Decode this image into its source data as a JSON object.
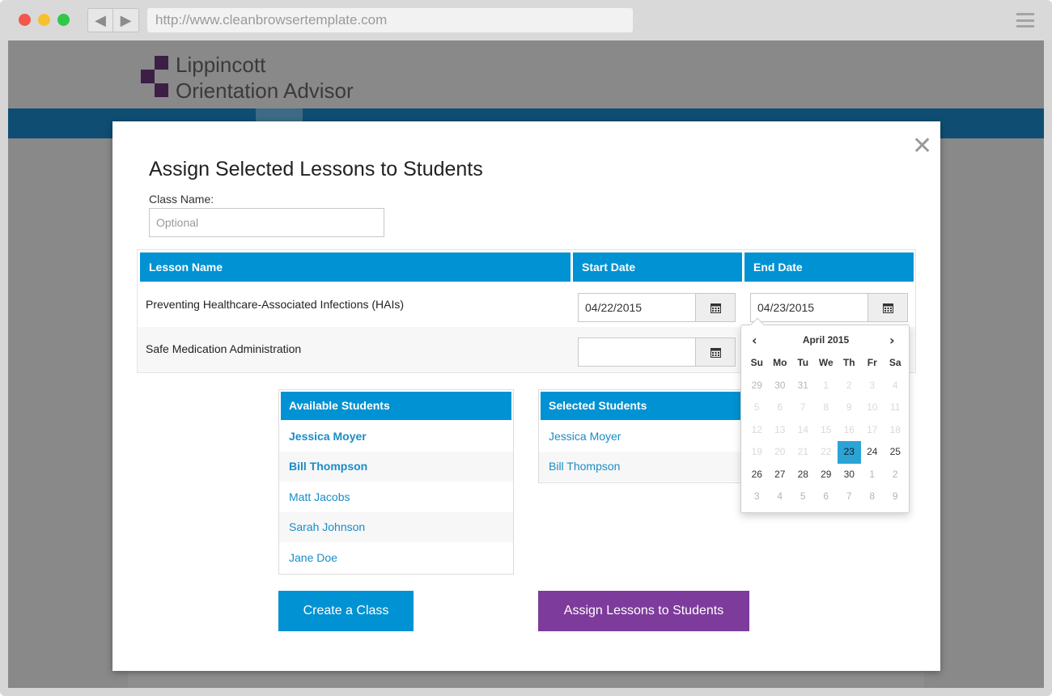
{
  "browser": {
    "url": "http://www.cleanbrowsertemplate.com"
  },
  "site": {
    "brand_line1": "Lippincott",
    "brand_line2": "Orientation Advisor",
    "colors": {
      "nav": "#0f4e72",
      "accent": "#0092d2",
      "purple": "#7d3b9b",
      "logo": "#3c1f45"
    }
  },
  "modal": {
    "title": "Assign Selected Lessons to Students",
    "class_label": "Class Name:",
    "class_placeholder": "Optional",
    "close_icon": "close-icon",
    "table": {
      "headers": [
        "Lesson Name",
        "Start Date",
        "End Date"
      ],
      "rows": [
        {
          "lesson": "Preventing Healthcare-Associated Infections (HAIs)",
          "start": "04/22/2015",
          "end": "04/23/2015"
        },
        {
          "lesson": "Safe Medication Administration",
          "start": "",
          "end": ""
        }
      ]
    },
    "available": {
      "header": "Available Students",
      "items": [
        "Jessica Moyer",
        "Bill Thompson",
        "Matt Jacobs",
        "Sarah Johnson",
        "Jane Doe"
      ]
    },
    "selected": {
      "header": "Selected Students",
      "items": [
        "Jessica Moyer",
        "Bill Thompson"
      ]
    },
    "buttons": {
      "create_class": "Create a Class",
      "assign": "Assign Lessons to Students"
    },
    "datepicker": {
      "month": "April 2015",
      "days_of_week": [
        "Su",
        "Mo",
        "Tu",
        "We",
        "Th",
        "Fr",
        "Sa"
      ],
      "weeks": [
        [
          "29",
          "30",
          "31",
          "1",
          "2",
          "3",
          "4"
        ],
        [
          "5",
          "6",
          "7",
          "8",
          "9",
          "10",
          "11"
        ],
        [
          "12",
          "13",
          "14",
          "15",
          "16",
          "17",
          "18"
        ],
        [
          "19",
          "20",
          "21",
          "22",
          "23",
          "24",
          "25"
        ],
        [
          "26",
          "27",
          "28",
          "29",
          "30",
          "1",
          "2"
        ],
        [
          "3",
          "4",
          "5",
          "6",
          "7",
          "8",
          "9"
        ]
      ],
      "selected": "23"
    }
  }
}
